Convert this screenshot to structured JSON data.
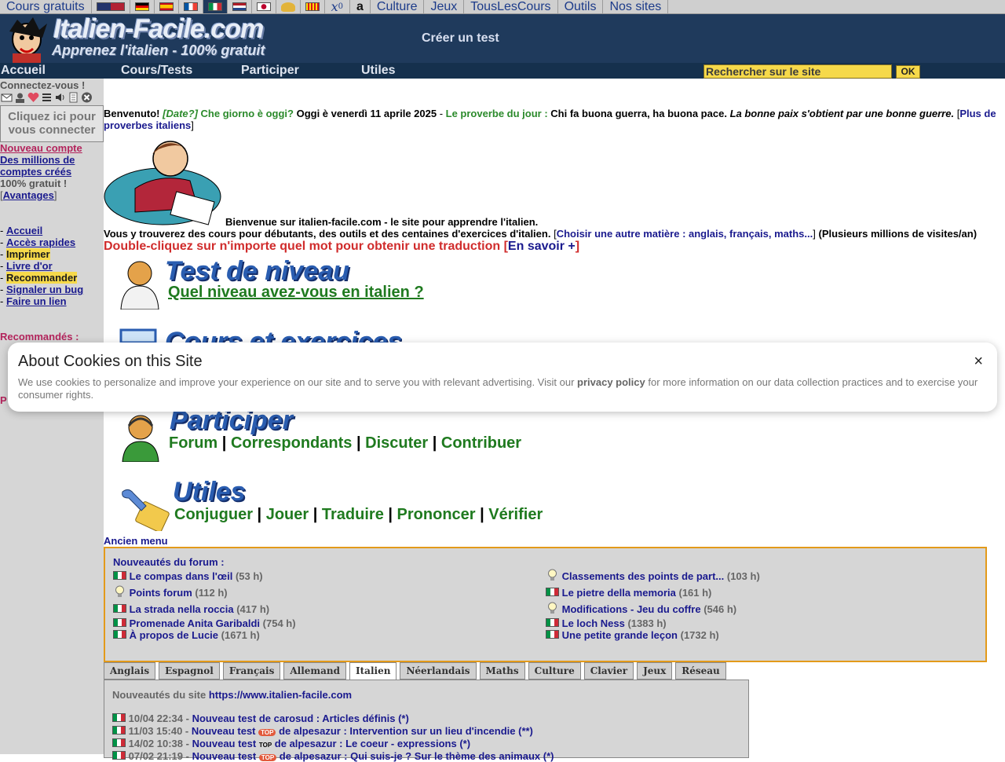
{
  "topbar": {
    "left_link": "Cours gratuits",
    "right_links": [
      "Culture",
      "Jeux",
      "TousLesCours",
      "Outils",
      "Nos sites"
    ],
    "flags": [
      "uk-us-flag",
      "german-flag",
      "spanish-flag",
      "french-flag",
      "italian-flag",
      "dutch-flag",
      "japanese-flag",
      "hat-icon",
      "catalan-flag",
      "math-icon",
      "letter-a-icon"
    ],
    "math_symbol": "x",
    "math_subscript": "0",
    "letter_symbol": "a"
  },
  "header": {
    "logo_title": "Italien-Facile.com",
    "logo_tagline": "Apprenez l'italien - 100% gratuit",
    "create_test": "Créer un test"
  },
  "menu": {
    "items": [
      "Accueil",
      "Cours/Tests",
      "Participer",
      "Utiles"
    ],
    "search_value": "Rechercher sur le site",
    "search_button": "OK"
  },
  "sidebar": {
    "connect_label": "Connectez-vous !",
    "login_box": [
      "Cliquez ici pour",
      "vous connecter"
    ],
    "new_account": "Nouveau compte",
    "millions": [
      "Des millions de",
      "comptes créés"
    ],
    "free": "100% gratuit !",
    "advantages": "Avantages",
    "links": [
      "Accueil",
      "Accès rapides",
      "Imprimer",
      "Livre d'or",
      "Recommander",
      "Signaler un bug",
      "Faire un lien"
    ],
    "recommended": "Recommandés :",
    "partial_p": "P"
  },
  "intro": {
    "benvenuto": "Benvenuto!",
    "date_q": "[Date?]",
    "giorno": "Che giorno è oggi?",
    "oggi": "Oggi è venerdì 11 aprile 2025",
    "proverbe_label": "Le proverbe du jour :",
    "proverbe_it": "Chi fa buona guerra, ha buona pace.",
    "proverbe_fr": "La bonne paix s'obtient par une bonne guerre.",
    "more_proverbs": "Plus de proverbes italiens",
    "welcome": "Bienvenue sur italien-facile.com - le site pour apprendre l'italien.",
    "line2": "Vous y trouverez des cours pour débutants, des outils et des centaines d'exercices d'italien.",
    "other_subject": "Choisir une autre matière : anglais, français, maths...",
    "visits": "(Plusieurs millions de visites/an)",
    "dblclick": "Double-cliquez sur n'importe quel mot pour obtenir une traduction",
    "en_savoir": "En savoir +"
  },
  "sections": {
    "test": {
      "title": "Test de niveau",
      "link": "Quel niveau avez-vous en italien ?"
    },
    "cours": {
      "title": "Cours et exercices"
    },
    "participer": {
      "title": "Participer",
      "links": [
        "Forum",
        "Correspondants",
        "Discuter",
        "Contribuer"
      ]
    },
    "utiles": {
      "title": "Utiles",
      "links": [
        "Conjuguer",
        "Jouer",
        "Traduire",
        "Prononcer",
        "Vérifier"
      ]
    },
    "old_menu": "Ancien menu"
  },
  "forum": {
    "title": "Nouveautés du forum :",
    "left": [
      {
        "label": "Le compas dans l'œil",
        "hours": "(53 h)"
      },
      {
        "label": "Points forum",
        "hours": "(112 h)"
      },
      {
        "label": "La strada nella roccia",
        "hours": "(417 h)"
      },
      {
        "label": "Promenade Anita Garibaldi",
        "hours": "(754 h)"
      },
      {
        "label": "À propos de Lucie",
        "hours": "(1671 h)"
      }
    ],
    "right": [
      {
        "label": "Classements des points de part...",
        "hours": "(103 h)"
      },
      {
        "label": "Le pietre della memoria",
        "hours": "(161 h)"
      },
      {
        "label": "Modifications - Jeu du coffre",
        "hours": "(546 h)"
      },
      {
        "label": "Le loch Ness",
        "hours": "(1383 h)"
      },
      {
        "label": "Une petite grande leçon",
        "hours": "(1732 h)"
      }
    ]
  },
  "tabs": [
    "Anglais",
    "Espagnol",
    "Français",
    "Allemand",
    "Italien",
    "Néerlandais",
    "Maths",
    "Culture",
    "Clavier",
    "Jeux",
    "Réseau"
  ],
  "news": {
    "label": "Nouveautés du site",
    "url": "https://www.italien-facile.com",
    "items": [
      {
        "date": "10/04 22:34 -",
        "text": "Nouveau test de carosud : Articles définis (*)"
      },
      {
        "date": "11/03 15:40 -",
        "text": "Nouveau test",
        "after": "de alpesazur : Intervention sur un lieu d'incendie (**)",
        "badge": "TOP"
      },
      {
        "date": "14/02 10:38 -",
        "text": "Nouveau test",
        "after": "de alpesazur : Le coeur - expressions (*)",
        "badge": "TOP"
      },
      {
        "date": "07/02 21:19 -",
        "text": "Nouveau test",
        "after": "de alpesazur : Qui suis-je ? Sur le thème des animaux (*)",
        "badge": "TOP"
      }
    ]
  },
  "cookie": {
    "title": "About Cookies on this Site",
    "close": "×",
    "text_before": "We use cookies to personalize and improve your experience on our site and to serve you with relevant advertising. Visit our",
    "policy": "privacy policy",
    "text_after": "for more information on our data collection practices and to exercise your consumer rights."
  }
}
